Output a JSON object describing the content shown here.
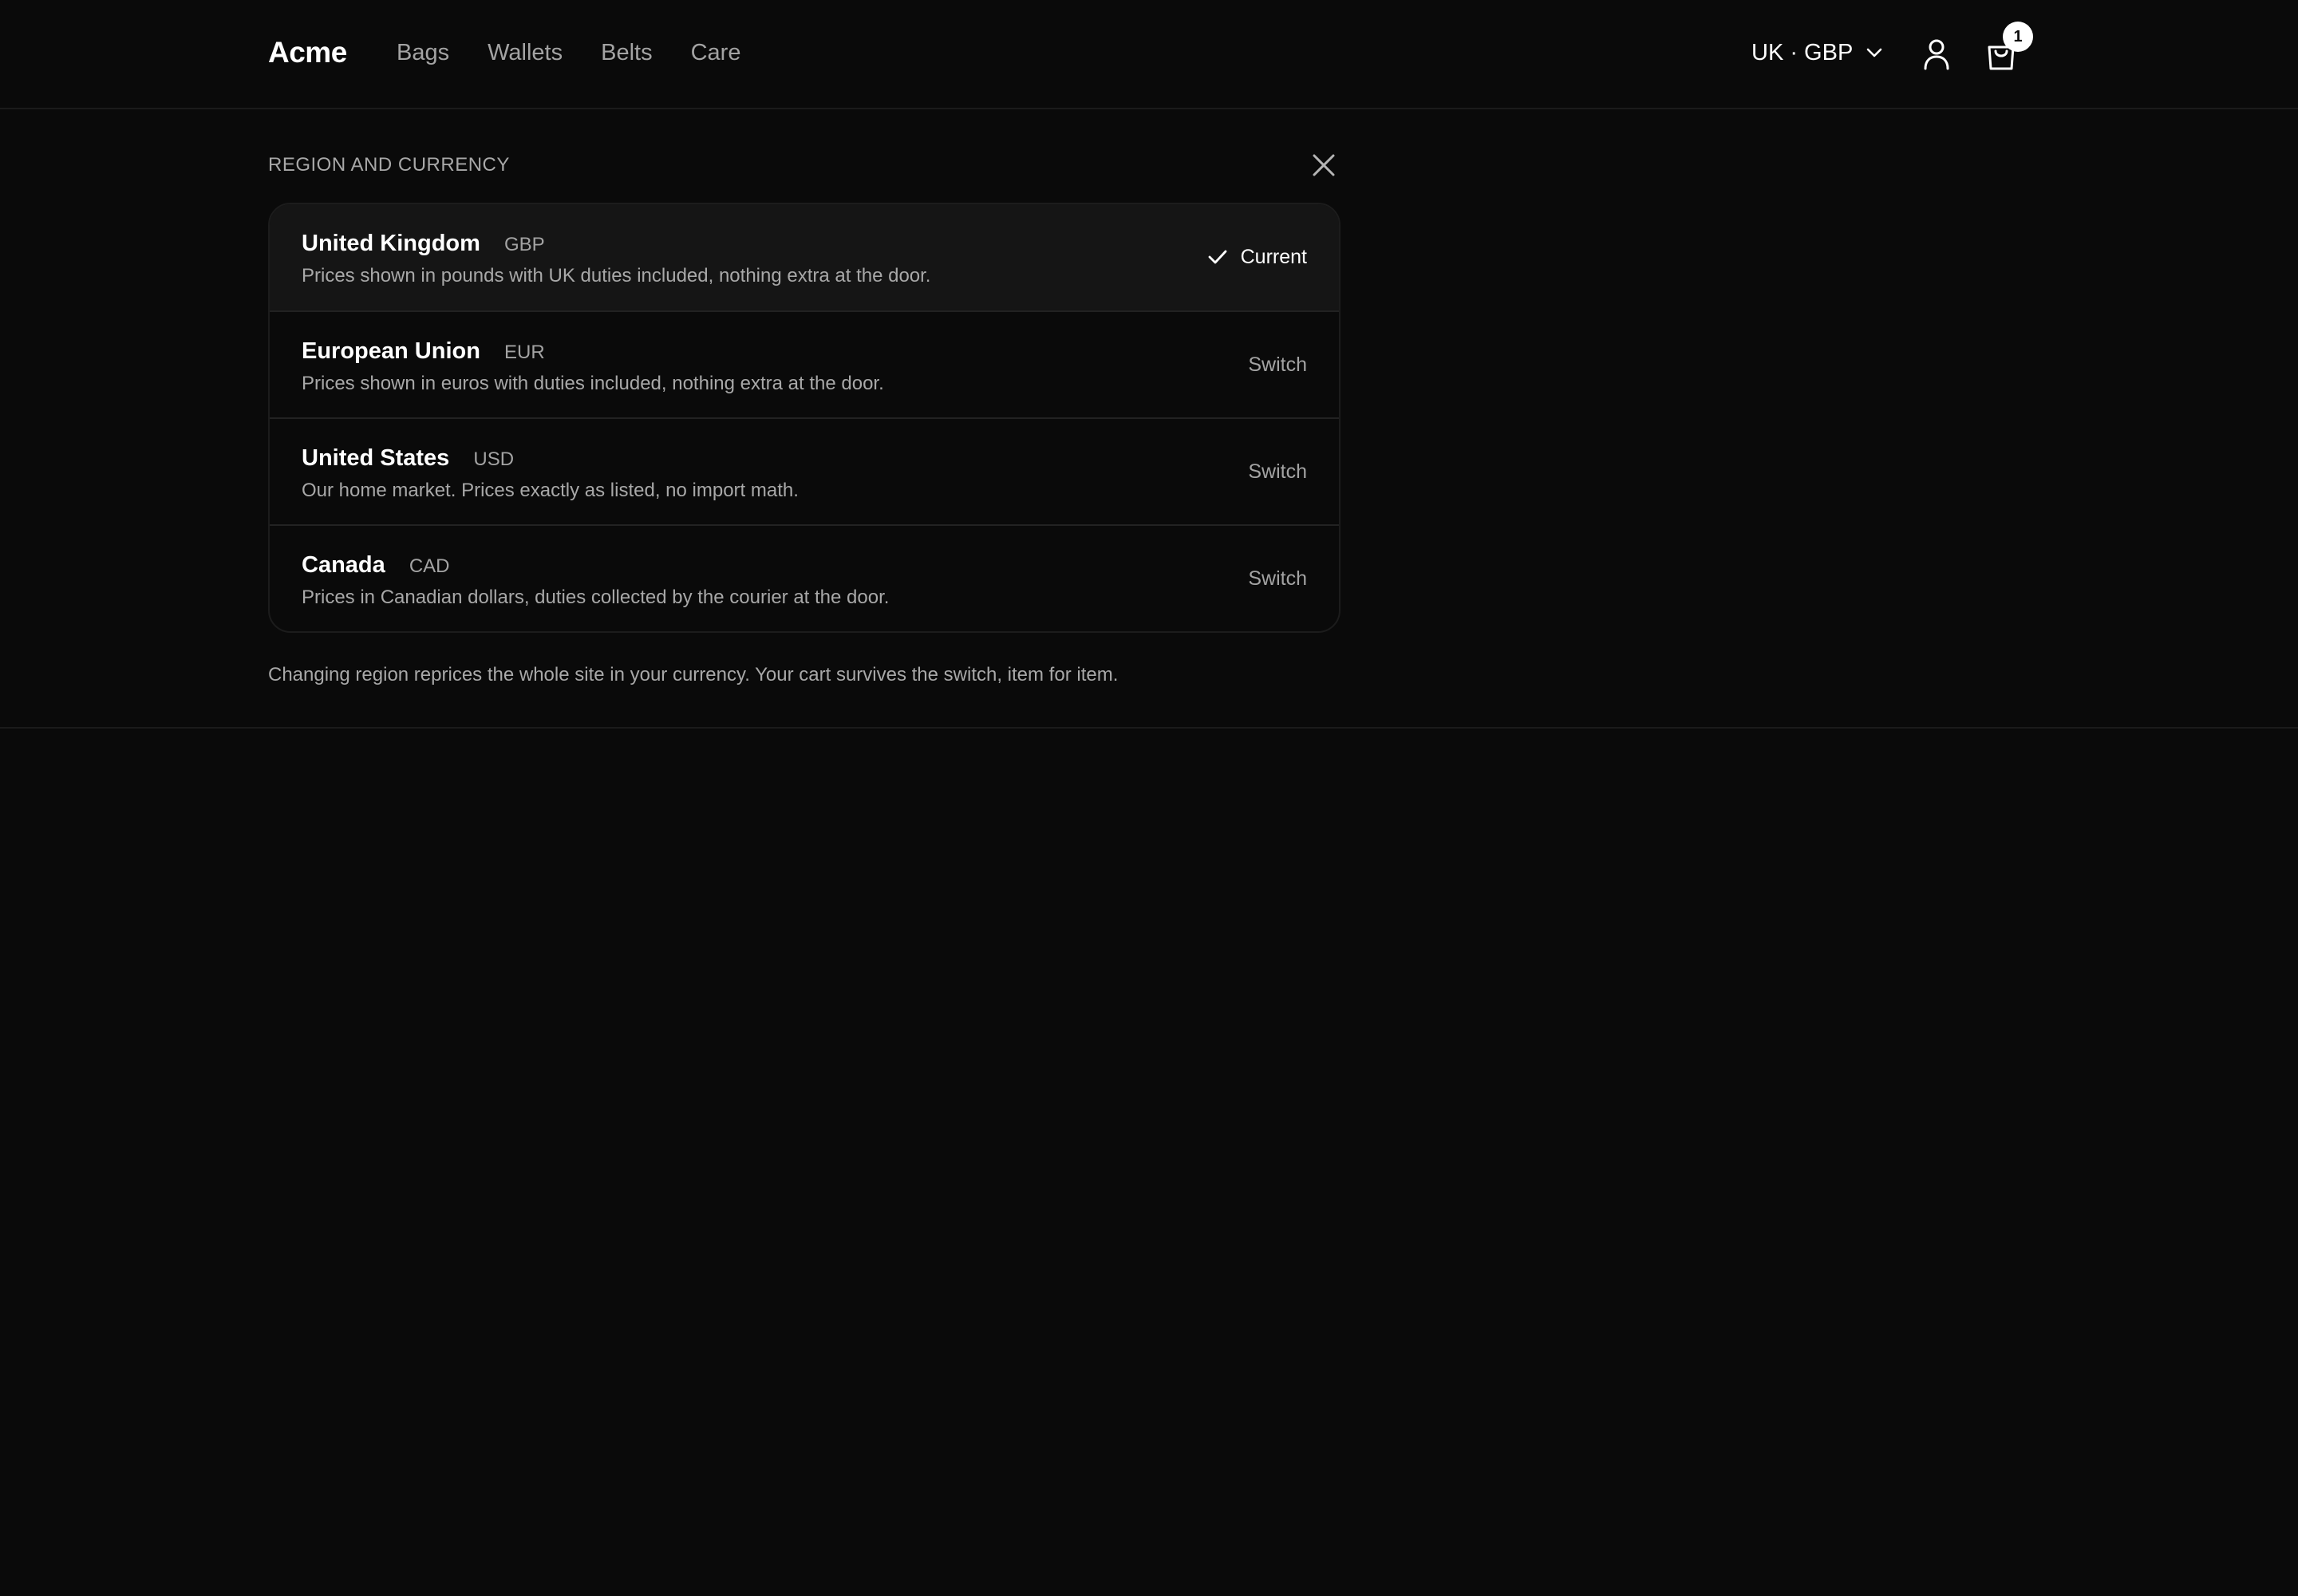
{
  "header": {
    "logo": "Acme",
    "nav": [
      "Bags",
      "Wallets",
      "Belts",
      "Care"
    ],
    "region_label": "UK · GBP",
    "cart_count": "1",
    "icons": {
      "region_chevron": "chevron-down-icon",
      "account": "user-icon",
      "cart": "shopping-bag-icon"
    }
  },
  "region_panel": {
    "title": "REGION AND CURRENCY",
    "close_icon": "close-icon",
    "regions": [
      {
        "name": "United Kingdom",
        "currency": "GBP",
        "description": "Prices shown in pounds with UK duties included, nothing extra at the door.",
        "action": "Current",
        "is_current": true
      },
      {
        "name": "European Union",
        "currency": "EUR",
        "description": "Prices shown in euros with duties included, nothing extra at the door.",
        "action": "Switch",
        "is_current": false
      },
      {
        "name": "United States",
        "currency": "USD",
        "description": "Our home market. Prices exactly as listed, no import math.",
        "action": "Switch",
        "is_current": false
      },
      {
        "name": "Canada",
        "currency": "CAD",
        "description": "Prices in Canadian dollars, duties collected by the courier at the door.",
        "action": "Switch",
        "is_current": false
      }
    ],
    "footnote": "Changing region reprices the whole site in your currency. Your cart survives the switch, item for item."
  },
  "colors": {
    "background": "#0a0a0a",
    "current_row": "#151515",
    "muted_text": "#a3a3a3",
    "badge": "#ffffff"
  }
}
